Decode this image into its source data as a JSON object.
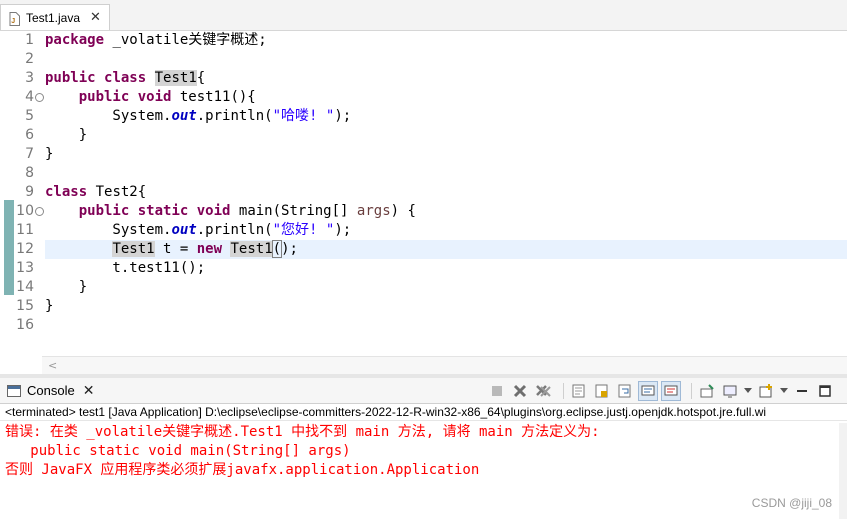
{
  "editor": {
    "tab_label": "Test1.java",
    "tab_close": "✕",
    "line_numbers": [
      "1",
      "2",
      "3",
      "4",
      "5",
      "6",
      "7",
      "8",
      "9",
      "10",
      "11",
      "12",
      "13",
      "14",
      "15",
      "16"
    ],
    "fold_symbol": "⊖",
    "code": {
      "l1_kw": "package",
      "l1_rest": " _volatile关键字概述;",
      "l3_kw1": "public",
      "l3_kw2": "class",
      "l3_name": "Test1",
      "l3_brace": "{",
      "l4_indent": "    ",
      "l4_kw1": "public",
      "l4_kw2": "void",
      "l4_rest": " test11(){",
      "l5_pre": "        System.",
      "l5_field": "out",
      "l5_mid": ".println(",
      "l5_str": "\"哈喽! \"",
      "l5_end": ");",
      "l6": "    }",
      "l7": "}",
      "l9_kw": "class",
      "l9_rest": " Test2{",
      "l10_indent": "    ",
      "l10_kw1": "public",
      "l10_kw2": "static",
      "l10_kw3": "void",
      "l10_mid": " main(String[] ",
      "l10_param": "args",
      "l10_end": ") {",
      "l11_pre": "        System.",
      "l11_field": "out",
      "l11_mid": ".println(",
      "l11_str": "\"您好! \"",
      "l11_end": ");",
      "l12_indent": "        ",
      "l12_type": "Test1",
      "l12_mid": " t = ",
      "l12_kw": "new",
      "l12_ctor": "Test1",
      "l12_paren_open": "(",
      "l12_paren_close": ")",
      "l12_end": ";",
      "l13": "        t.test11();",
      "l14": "    }",
      "l15": "}"
    },
    "scroll_arrow": "<"
  },
  "console": {
    "tab_label": "Console",
    "tab_close": "✕",
    "status": "<terminated> test1 [Java Application] D:\\eclipse\\eclipse-committers-2022-12-R-win32-x86_64\\plugins\\org.eclipse.justj.openjdk.hotspot.jre.full.wi",
    "output": [
      "错误: 在类 _volatile关键字概述.Test1 中找不到 main 方法, 请将 main 方法定义为:",
      "   public static void main(String[] args)",
      "否则 JavaFX 应用程序类必须扩展javafx.application.Application"
    ],
    "toolbar_icons": [
      "terminate-icon",
      "remove-launch-icon",
      "remove-all-icon",
      "clear-console-icon",
      "scroll-lock-icon",
      "word-wrap-icon",
      "show-stdout-icon",
      "show-stderr-icon",
      "pin-console-icon",
      "display-console-icon",
      "new-console-icon",
      "minimize-icon",
      "maximize-icon"
    ],
    "colors": {
      "error_text": "#ff0000",
      "keyword": "#7f0055",
      "string": "#2a00ff",
      "field": "#0000c0"
    }
  },
  "watermark": "CSDN @jiji_08"
}
